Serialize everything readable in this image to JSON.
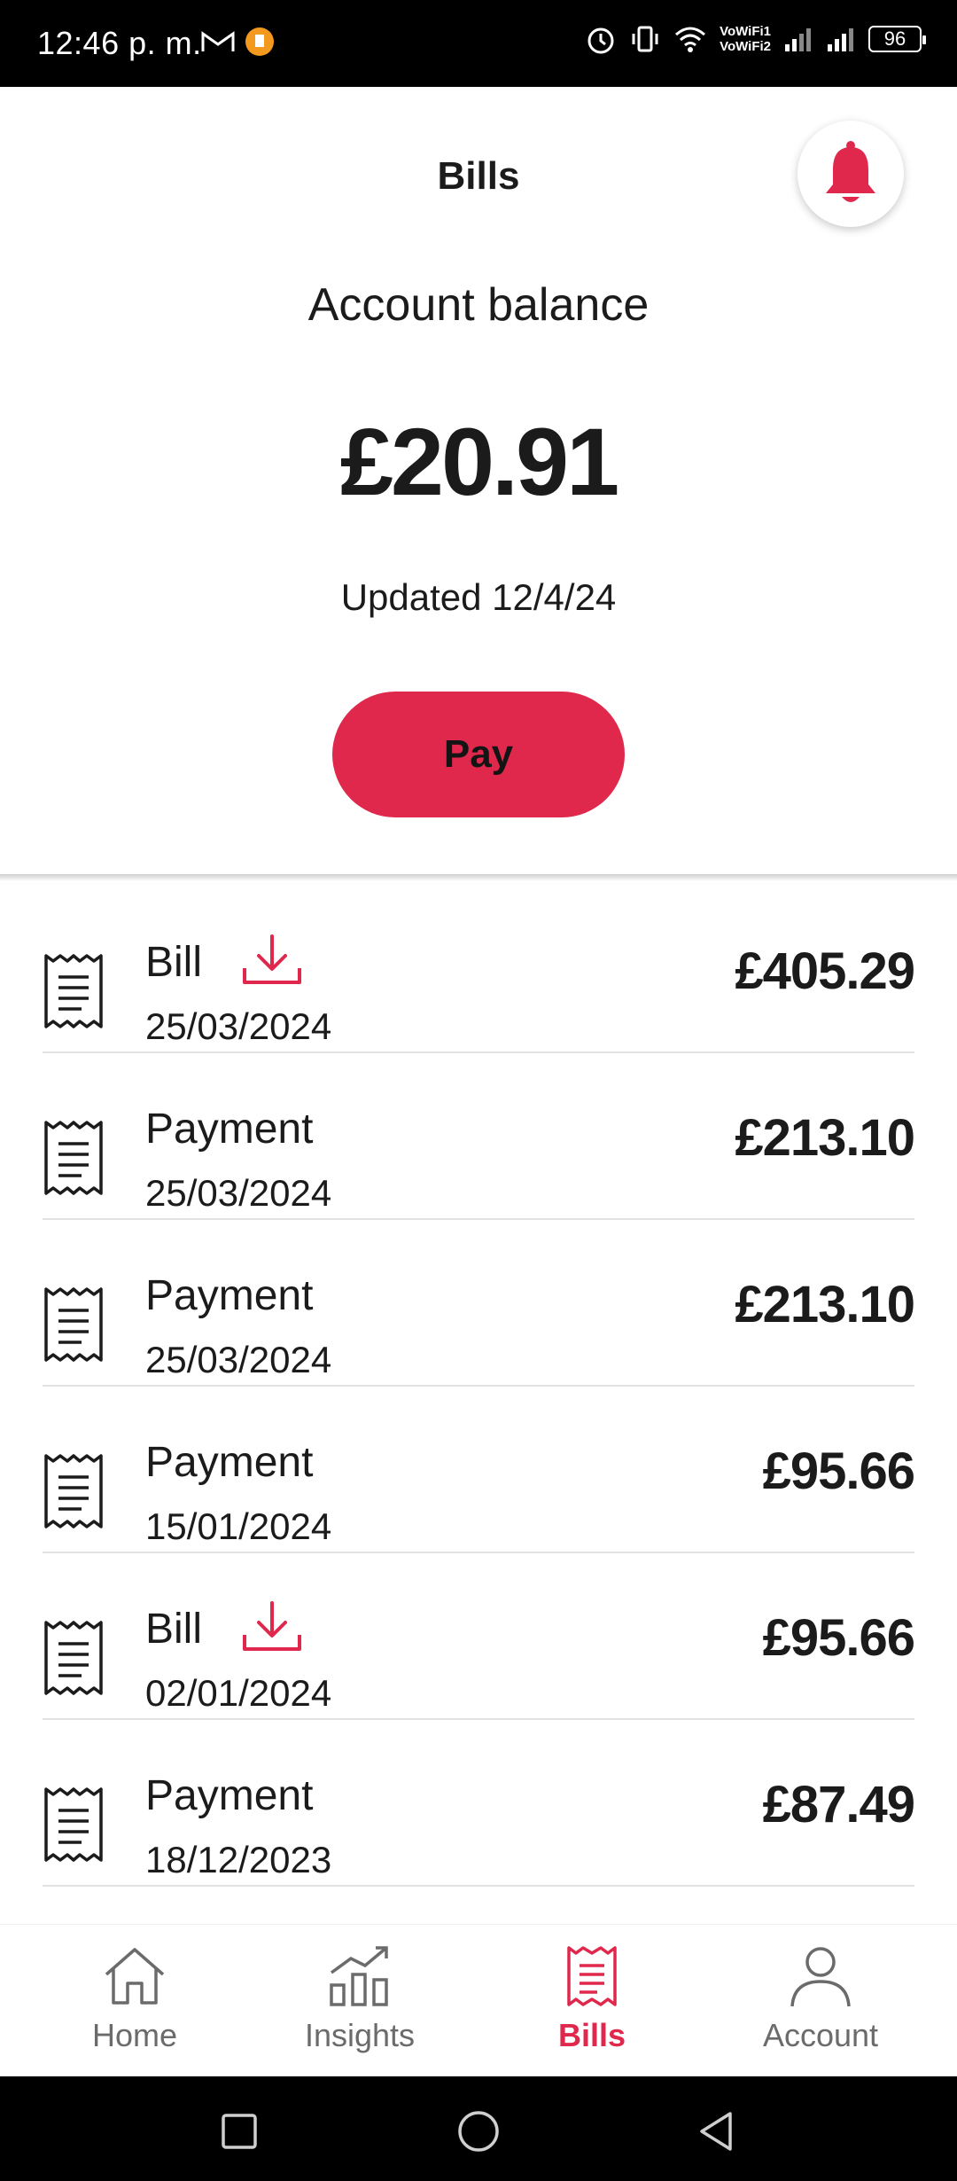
{
  "status_bar": {
    "time": "12:46 p. m.",
    "vowifi_1": "VoWiFi1",
    "vowifi_2": "VoWiFi2",
    "battery": "96"
  },
  "header": {
    "title": "Bills",
    "balance_label": "Account balance",
    "balance_amount": "£20.91",
    "updated": "Updated 12/4/24",
    "pay_label": "Pay"
  },
  "transactions": [
    {
      "type": "Bill",
      "date": "25/03/2024",
      "amount": "£405.29",
      "download": true
    },
    {
      "type": "Payment",
      "date": "25/03/2024",
      "amount": "£213.10",
      "download": false
    },
    {
      "type": "Payment",
      "date": "25/03/2024",
      "amount": "£213.10",
      "download": false
    },
    {
      "type": "Payment",
      "date": "15/01/2024",
      "amount": "£95.66",
      "download": false
    },
    {
      "type": "Bill",
      "date": "02/01/2024",
      "amount": "£95.66",
      "download": true
    },
    {
      "type": "Payment",
      "date": "18/12/2023",
      "amount": "£87.49",
      "download": false
    }
  ],
  "bottom_nav": {
    "items": [
      {
        "label": "Home",
        "icon": "home-icon"
      },
      {
        "label": "Insights",
        "icon": "insights-icon"
      },
      {
        "label": "Bills",
        "icon": "bills-icon",
        "active": true
      },
      {
        "label": "Account",
        "icon": "account-icon"
      }
    ]
  },
  "colors": {
    "accent": "#e0284c",
    "text": "#1b1b1b",
    "muted": "#6b6b6b"
  }
}
